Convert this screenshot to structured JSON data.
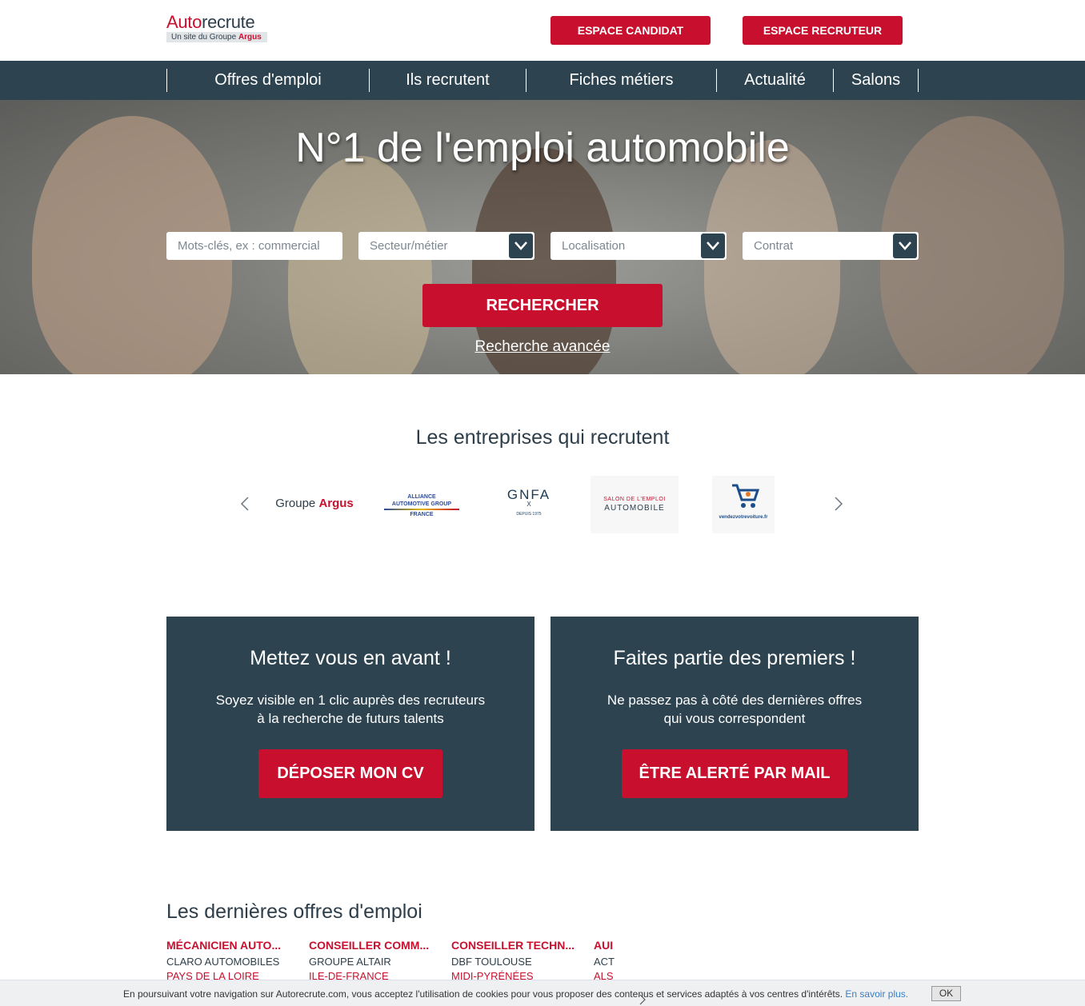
{
  "header": {
    "logo_auto": "Auto",
    "logo_recrute": "recrute",
    "logo_sub_prefix": "Un site du Groupe ",
    "logo_sub_brand": "Argus",
    "btn_candidat": "ESPACE CANDIDAT",
    "btn_recruteur": "ESPACE RECRUTEUR"
  },
  "nav": {
    "items": [
      "Offres d'emploi",
      "Ils recrutent",
      "Fiches métiers",
      "Actualité",
      "Salons"
    ]
  },
  "hero": {
    "title": "N°1 de l'emploi automobile",
    "keywords_placeholder": "Mots-clés, ex : commercial",
    "secteur": "Secteur/métier",
    "localisation": "Localisation",
    "contrat": "Contrat",
    "search_button": "RECHERCHER",
    "advanced_link": "Recherche avancée"
  },
  "companies": {
    "title": "Les entreprises qui recrutent",
    "logos": [
      {
        "line1": "Groupe",
        "line2": "Argus"
      },
      {
        "line1": "ALLIANCE",
        "line2": "AUTOMOTIVE GROUP",
        "line3": "FRANCE"
      },
      {
        "line1": "GNFA",
        "line2": "X",
        "line3": "DEPUIS 1975"
      },
      {
        "line1": "SALON DE L'EMPLOI",
        "line2": "AUTOMOBILE"
      },
      {
        "line1": "vendezvotrevoiture.fr"
      }
    ]
  },
  "cta": {
    "left": {
      "title": "Mettez vous en avant !",
      "line1": "Soyez visible en 1 clic auprès des recruteurs",
      "line2": "à la recherche de futurs talents",
      "button": "DÉPOSER MON CV"
    },
    "right": {
      "title": "Faites partie des premiers !",
      "line1": "Ne passez pas à côté des dernières offres",
      "line2": "qui vous correspondent",
      "button": "ÊTRE ALERTÉ PAR MAIL"
    }
  },
  "offers": {
    "title": "Les dernières offres d'emploi",
    "items": [
      {
        "title": "MÉCANICIEN AUTO...",
        "company": "CLARO AUTOMOBILES",
        "region": "PAYS DE LA LOIRE"
      },
      {
        "title": "CONSEILLER COMM...",
        "company": "GROUPE ALTAIR",
        "region": "ILE-DE-FRANCE"
      },
      {
        "title": "CONSEILLER TECHN...",
        "company": "DBF TOULOUSE",
        "region": "MIDI-PYRÉNÉES"
      },
      {
        "title": "AUI",
        "company": "ACT",
        "region": "ALS"
      }
    ]
  },
  "cookie": {
    "text": "En poursuivant votre navigation sur Autorecrute.com, vous acceptez l'utilisation de cookies pour vous proposer des contenus et services adaptés à vos centres d'intérêts.",
    "link": "En savoir plus.",
    "ok": "OK"
  },
  "colors": {
    "brand_red": "#c8102e",
    "navy": "#2d4350"
  }
}
